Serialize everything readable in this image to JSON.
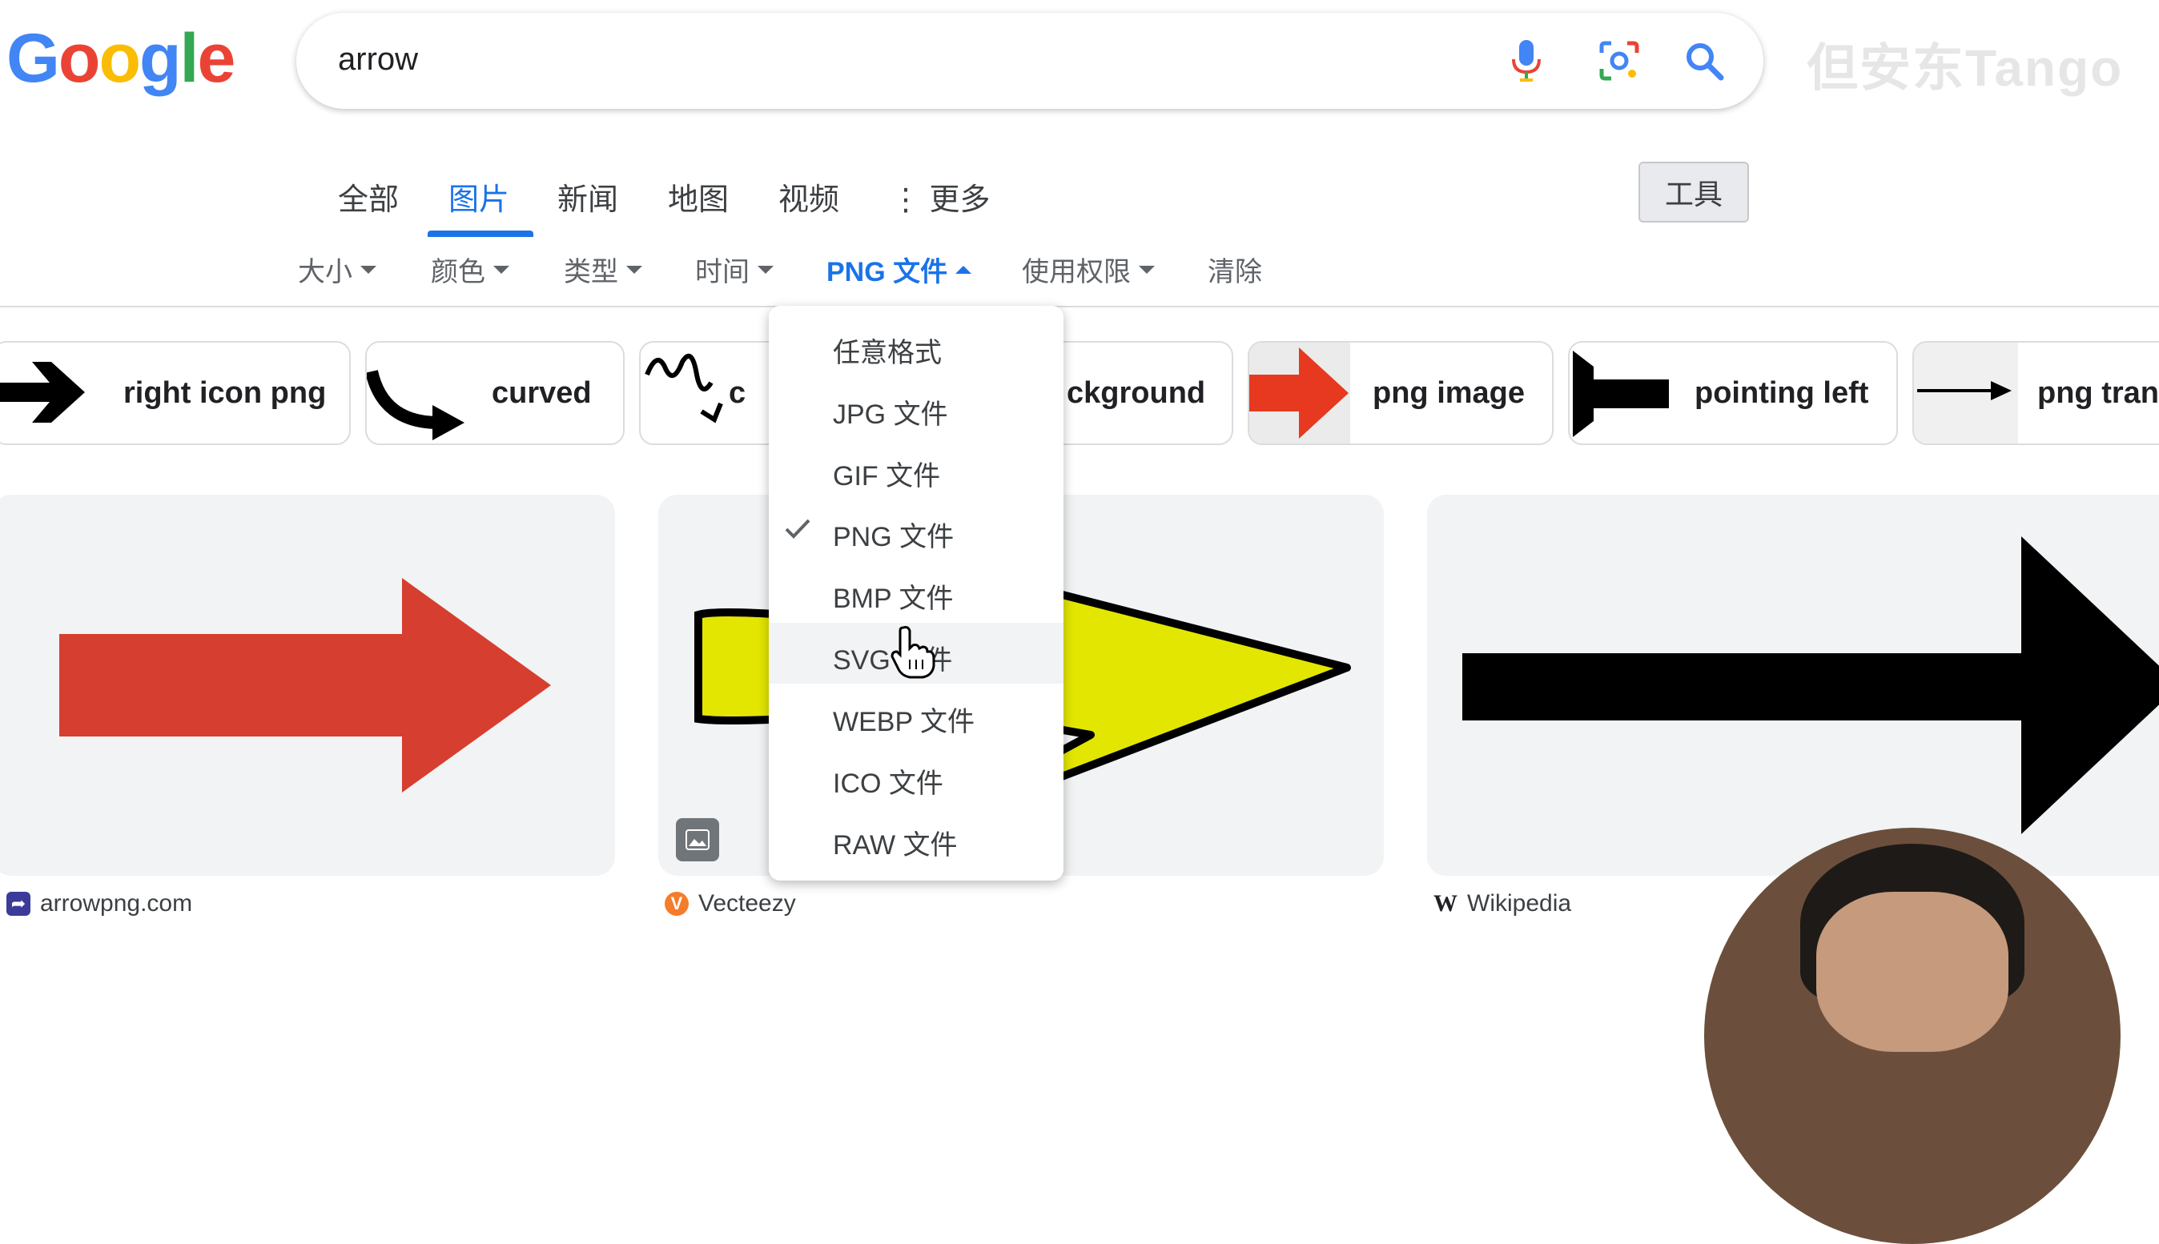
{
  "logo": [
    "G",
    "o",
    "o",
    "g",
    "l",
    "e"
  ],
  "logo_colors": [
    "#4285f4",
    "#ea4335",
    "#fbbc05",
    "#4285f4",
    "#34a853",
    "#ea4335"
  ],
  "search": {
    "query": "arrow"
  },
  "watermark": "但安东Tango",
  "tabs": [
    {
      "label": "全部"
    },
    {
      "label": "图片",
      "active": true
    },
    {
      "label": "新闻"
    },
    {
      "label": "地图"
    },
    {
      "label": "视频"
    },
    {
      "label": "⋮ 更多"
    }
  ],
  "tools_label": "工具",
  "filters": [
    {
      "label": "大小"
    },
    {
      "label": "颜色"
    },
    {
      "label": "类型"
    },
    {
      "label": "时间"
    },
    {
      "label": "PNG 文件",
      "active": true
    },
    {
      "label": "使用权限"
    },
    {
      "label": "清除"
    }
  ],
  "chips": [
    {
      "label": "right icon png"
    },
    {
      "label": "curved"
    },
    {
      "label": "c"
    },
    {
      "label": "ckground"
    },
    {
      "label": "png image"
    },
    {
      "label": "pointing left"
    },
    {
      "label": "png trans"
    }
  ],
  "dropdown": {
    "items": [
      {
        "label": "任意格式"
      },
      {
        "label": "JPG 文件"
      },
      {
        "label": "GIF 文件"
      },
      {
        "label": "PNG 文件",
        "checked": true
      },
      {
        "label": "BMP 文件"
      },
      {
        "label": "SVG 文件",
        "hovered": true
      },
      {
        "label": "WEBP 文件"
      },
      {
        "label": "ICO 文件"
      },
      {
        "label": "RAW 文件"
      }
    ]
  },
  "results": [
    {
      "source": "arrowpng.com",
      "icon_color": "#3b3b9a"
    },
    {
      "source": "Vecteezy",
      "icon_color": "#f57c2a"
    },
    {
      "source": "Wikipedia",
      "icon_color": "#202124"
    }
  ],
  "colors": {
    "accent": "#1a73e8",
    "red_arrow": "#d63e2f",
    "yellow_arrow": "#e3e600"
  }
}
